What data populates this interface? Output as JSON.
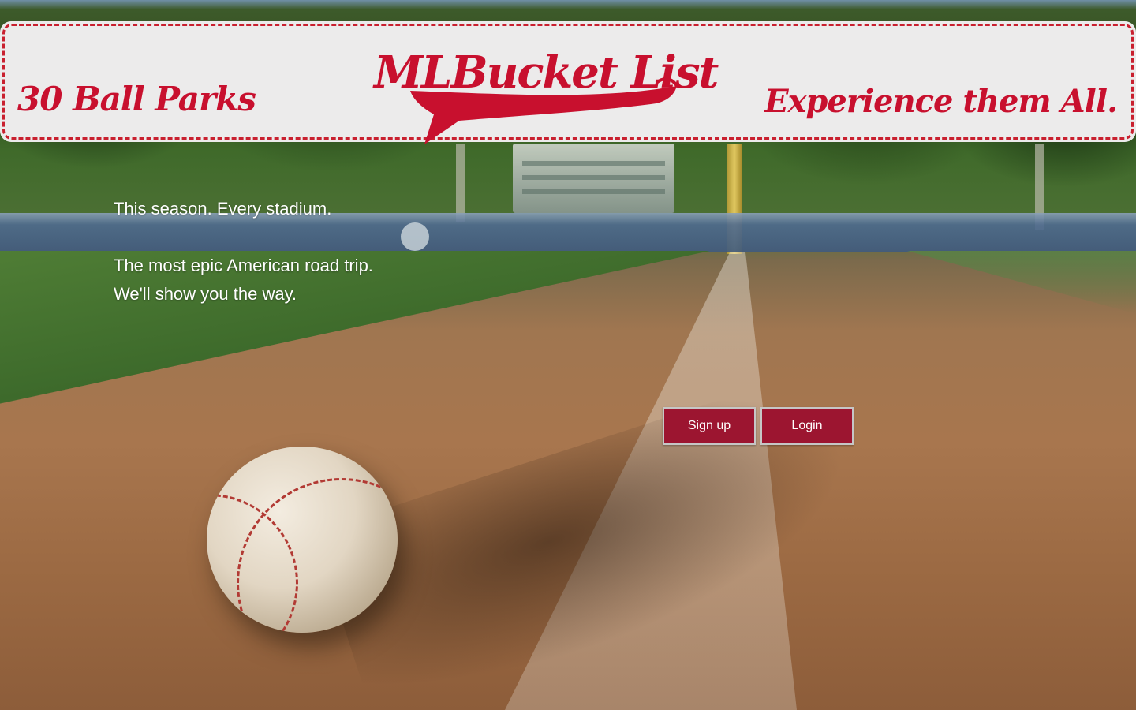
{
  "header": {
    "tagline_left": "30 Ball Parks",
    "logo_text": "MLBucket List",
    "tagline_right": "Experience them All."
  },
  "intro": {
    "line1": "This season. Every stadium.",
    "line2": "The most epic American road trip. We'll show you the way."
  },
  "actions": {
    "signup_label": "Sign up",
    "login_label": "Login"
  },
  "colors": {
    "brand_red": "#c8102e",
    "button_red": "#9c1530",
    "banner_bg": "#ecebeb"
  },
  "icons": {
    "hero": "baseball-on-infield-photo"
  }
}
